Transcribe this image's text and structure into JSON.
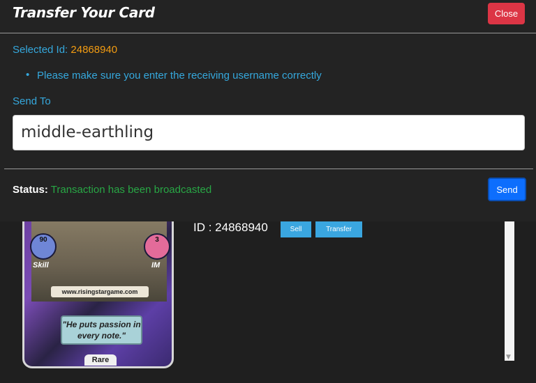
{
  "modal": {
    "title": "Transfer Your Card",
    "close_label": "Close",
    "selected_label": "Selected Id:",
    "selected_value": "24868940",
    "bullet": "•",
    "note": "Please make sure you enter the receiving username correctly",
    "send_to_label": "Send To",
    "send_to_value": "middle-earthling",
    "status_label": "Status:",
    "status_value": "Transaction has been broadcasted",
    "send_label": "Send"
  },
  "card": {
    "skill_value": "90",
    "skill_label": "Skill",
    "im_value": "3",
    "im_label": "IM",
    "website": "www.risingstargame.com",
    "quote": "\"He puts passion in every note.\"",
    "rarity": "Rare",
    "id_text": "ID : 24868940",
    "sell_label": "Sell",
    "transfer_label": "Transfer"
  },
  "colors": {
    "accent_blue": "#35a8dd",
    "id_orange": "#f39c12",
    "status_green": "#28a745",
    "close_red": "#dc3545",
    "send_blue": "#0d6efd"
  }
}
